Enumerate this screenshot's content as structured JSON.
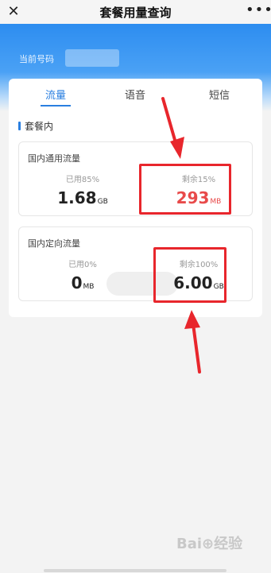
{
  "header": {
    "title": "套餐用量查询",
    "close_icon": "close-icon",
    "more_icon": "more-icon",
    "more_glyph": "•••",
    "close_glyph": "✕"
  },
  "account": {
    "phone_label": "当前号码"
  },
  "tabs": [
    {
      "label": "流量",
      "active": true
    },
    {
      "label": "语音",
      "active": false
    },
    {
      "label": "短信",
      "active": false
    }
  ],
  "section": {
    "title": "套餐内"
  },
  "packages": [
    {
      "title": "国内通用流量",
      "used_label": "已用85%",
      "used_value": "1.68",
      "used_unit": "GB",
      "remaining_label": "剩余15%",
      "remaining_value": "293",
      "remaining_unit": "MB"
    },
    {
      "title": "国内定向流量",
      "used_label": "已用0%",
      "used_value": "0",
      "used_unit": "MB",
      "remaining_label": "剩余100%",
      "remaining_value": "6.00",
      "remaining_unit": "GB"
    }
  ],
  "watermark": "Bai⊕经验",
  "colors": {
    "accent": "#2a7fe0",
    "highlight": "#e8262c",
    "remaining_red": "#e84a4a"
  }
}
